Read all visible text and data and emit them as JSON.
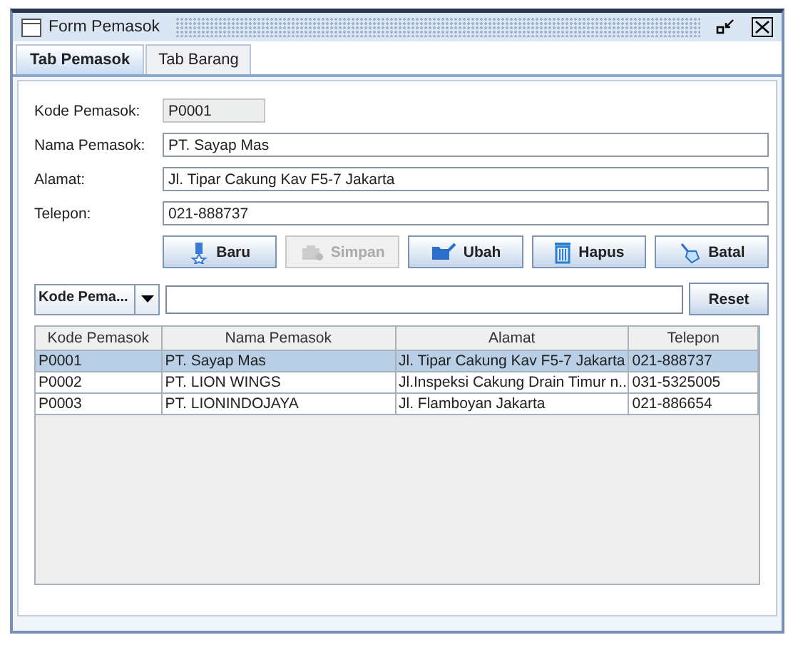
{
  "window": {
    "title": "Form Pemasok"
  },
  "tabs": [
    {
      "label": "Tab Pemasok",
      "selected": true
    },
    {
      "label": "Tab Barang",
      "selected": false
    }
  ],
  "form": {
    "fields": [
      {
        "label": "Kode Pemasok:",
        "value": "P0001",
        "disabled": true
      },
      {
        "label": "Nama Pemasok:",
        "value": "PT. Sayap Mas",
        "disabled": false
      },
      {
        "label": "Alamat:",
        "value": "Jl. Tipar Cakung Kav F5-7 Jakarta",
        "disabled": false
      },
      {
        "label": "Telepon:",
        "value": "021-888737",
        "disabled": false
      }
    ]
  },
  "buttons": [
    {
      "label": "Baru",
      "kind": "new",
      "disabled": false
    },
    {
      "label": "Simpan",
      "kind": "save",
      "disabled": true
    },
    {
      "label": "Ubah",
      "kind": "edit",
      "disabled": false
    },
    {
      "label": "Hapus",
      "kind": "delete",
      "disabled": false
    },
    {
      "label": "Batal",
      "kind": "cancel",
      "disabled": false
    }
  ],
  "search": {
    "combo_value": "Kode Pema...",
    "reset_label": "Reset"
  },
  "table": {
    "columns": [
      "Kode Pemasok",
      "Nama Pemasok",
      "Alamat",
      "Telepon"
    ],
    "rows": [
      {
        "cells": [
          "P0001",
          "PT. Sayap Mas",
          "Jl. Tipar Cakung Kav F5-7 Jakarta",
          "021-888737"
        ],
        "selected": true
      },
      {
        "cells": [
          "P0002",
          "PT. LION WINGS",
          "Jl.Inspeksi Cakung Drain Timur n...",
          "031-5325005"
        ],
        "selected": false
      },
      {
        "cells": [
          "P0003",
          "PT. LIONINDOJAYA",
          "Jl. Flamboyan Jakarta",
          "021-886654"
        ],
        "selected": false
      }
    ]
  }
}
